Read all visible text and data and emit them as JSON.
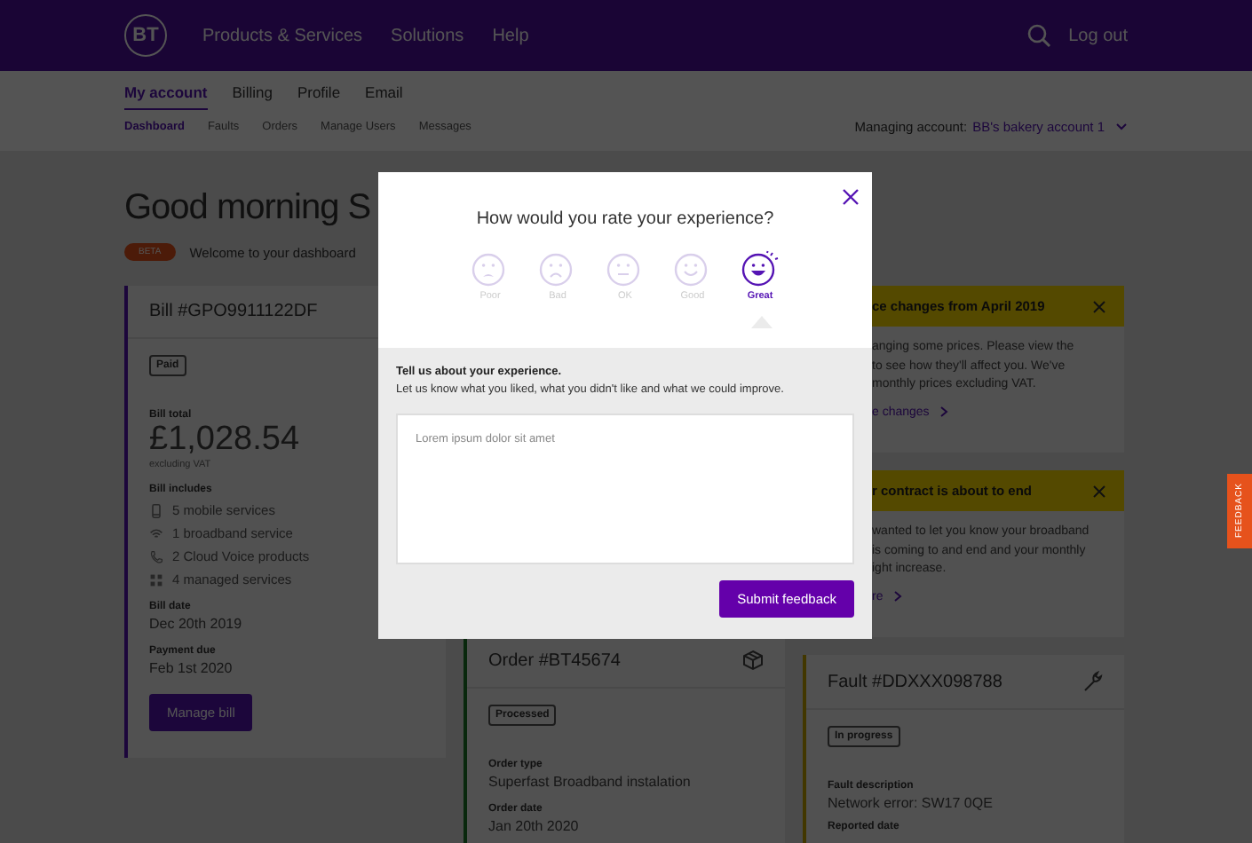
{
  "header": {
    "logo": "BT",
    "nav": [
      "Products & Services",
      "Solutions",
      "Help"
    ],
    "logout": "Log out"
  },
  "account_tabs": [
    {
      "label": "My account",
      "selected": true
    },
    {
      "label": "Billing",
      "selected": false
    },
    {
      "label": "Profile",
      "selected": false
    },
    {
      "label": "Email",
      "selected": false
    }
  ],
  "section_tabs": [
    {
      "label": "Dashboard",
      "selected": true
    },
    {
      "label": "Faults",
      "selected": false
    },
    {
      "label": "Orders",
      "selected": false
    },
    {
      "label": "Manage Users",
      "selected": false
    },
    {
      "label": "Messages",
      "selected": false
    }
  ],
  "managing_account": {
    "label": "Managing account:",
    "account": "BB's bakery account 1"
  },
  "greeting": "Good morning S",
  "beta_badge": "BETA",
  "welcome": "Welcome to your dashboard",
  "bill_card": {
    "title": "Bill #GPO9911122DF",
    "status": "Paid",
    "total_label": "Bill total",
    "total": "£1,028.54",
    "total_note": "excluding VAT",
    "includes_label": "Bill includes",
    "includes": [
      {
        "kind": "mobile",
        "text": "5 mobile services"
      },
      {
        "kind": "broadband",
        "text": "1 broadband service"
      },
      {
        "kind": "voice",
        "text": "2 Cloud Voice products"
      },
      {
        "kind": "managed",
        "text": "4 managed services"
      }
    ],
    "fields": [
      {
        "label": "Bill date",
        "value": "Dec 20th 2019"
      },
      {
        "label": "Payment due",
        "value": "Feb 1st 2020"
      }
    ],
    "button": "Manage bill"
  },
  "order_card": {
    "title": "Order #BT45674",
    "status": "Processed",
    "fields": [
      {
        "label": "Order type",
        "value": "Superfast Broadband instalation"
      },
      {
        "label": "Order date",
        "value": "Jan 20th 2020"
      }
    ]
  },
  "notices": [
    {
      "title": "ce changes from April 2019",
      "lines": [
        "anging some prices. Please view the",
        "to see how they'll affect you. We've",
        "monthly prices excluding VAT."
      ],
      "link": "e changes"
    },
    {
      "title": "r contract is about to end",
      "lines": [
        "wanted to let you know your broadband",
        "is coming to and end and your monthly",
        "ight increase."
      ],
      "link": "re"
    }
  ],
  "fault_card": {
    "title": "Fault #DDXXX098788",
    "status": "In progress",
    "fields": [
      {
        "label": "Fault description",
        "value": "Network error: SW17 0QE"
      }
    ],
    "cut_label": "Reported date"
  },
  "feedback_tab": "FEEDBACK",
  "modal": {
    "title": "How would you rate your experience?",
    "ratings": [
      {
        "kind": "poor",
        "label": "Poor",
        "selected": false
      },
      {
        "kind": "bad",
        "label": "Bad",
        "selected": false
      },
      {
        "kind": "ok",
        "label": "OK",
        "selected": false
      },
      {
        "kind": "good",
        "label": "Good",
        "selected": false
      },
      {
        "kind": "great",
        "label": "Great",
        "selected": true
      }
    ],
    "prompt_title": "Tell us about your experience.",
    "prompt_text": "Let us know what you liked, what you didn't like and what we could improve.",
    "comment": {
      "placeholder": "Lorem ipsum dolor sit amet"
    },
    "submit": "Submit feedback"
  }
}
